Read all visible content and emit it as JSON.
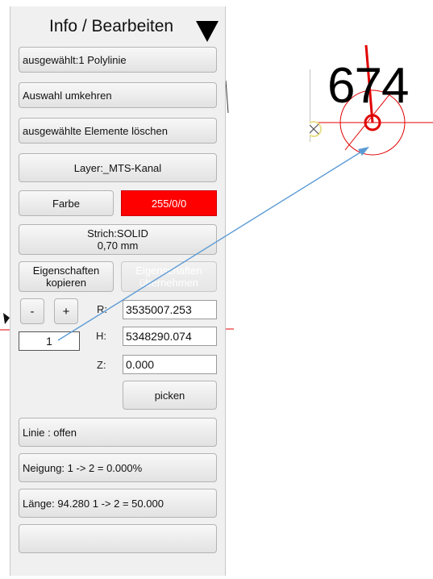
{
  "panel": {
    "title": "Info / Bearbeiten",
    "selection_label": "ausgewählt:1 Polylinie",
    "invert_selection_label": "Auswahl umkehren",
    "delete_selected_label": "ausgewählte Elemente löschen",
    "layer_label": "Layer:_MTS-Kanal",
    "color_label": "Farbe",
    "color_value": "255/0/0",
    "color_hex": "#ff0000",
    "stroke_line1": "Strich:SOLID",
    "stroke_line2": "0,70 mm",
    "copy_props_line1": "Eigenschaften",
    "copy_props_line2": "kopieren",
    "apply_props_line1": "Eigenschaften",
    "apply_props_line2": "übernehmen",
    "minus_label": "-",
    "plus_label": "+",
    "vertex_index": "1",
    "r_label": "R:",
    "r_value": "3535007.253",
    "h_label": "H:",
    "h_value": "5348290.074",
    "z_label": "Z:",
    "z_value": "0.000",
    "pick_label": "picken",
    "line_status": "Linie : offen",
    "slope_label": "Neigung: 1 -> 2 = 0.000%",
    "length_label": "Länge: 94.280  1 -> 2 = 50.000",
    "empty_label": ""
  },
  "inset": {
    "number_text": "674"
  },
  "colors": {
    "accent_arrow": "#5b9bd5",
    "drawing_red": "#e00000"
  }
}
